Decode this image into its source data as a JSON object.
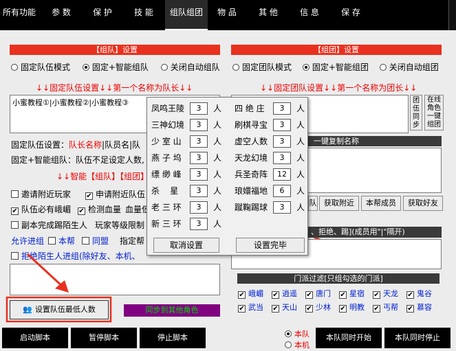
{
  "tabs": [
    "所有功能",
    "参 数",
    "保 护",
    "技 能",
    "组队组团",
    "物 品",
    "其 他",
    "信 息",
    "保 存"
  ],
  "team": {
    "header": "【组队】设置",
    "mode_options": [
      "固定队伍模式",
      "固定+智能组队",
      "关闭自动组队"
    ],
    "rule": "↓↓固定队伍设置↓↓第一个名称为队长↓↓",
    "textbox_value": "小蜜教程①|小蜜教程②|小蜜教程③",
    "note1_label": "固定队伍设置：",
    "note1_red": "队长名称",
    "note1_rest": "|队员名|队",
    "note2": "固定+智能组队：队伍不足设定人数,",
    "smart_label": "↓↓智能【组队】【组团】",
    "cb_invite": "邀请附近玩家",
    "cb_apply": "申请附近队伍",
    "cb_emei": "队伍必有峨嵋",
    "cb_hp": "检测血量",
    "hp_label": "血量低于",
    "cb_kick": "副本完成踢陌生人",
    "level_label": "玩家等级限制",
    "allow_label": "允许进组",
    "allow_opts": [
      "本帮",
      "同盟",
      "指定帮"
    ],
    "cb_refuse": "拒绝陌生人进组(除好友、本机、",
    "min_btn": "设置队伍最低人数",
    "sync_btn": "同步到其他角色"
  },
  "group": {
    "header": "【组团】设置",
    "mode_options": [
      "固定团队模式",
      "固定+智能组团",
      "关闭自动组团"
    ],
    "rule": "↓↓固定团队设置↓↓第一个名称为团长↓↓",
    "side_btn1": "团伍同步",
    "side_btn2": "在线角色一键组团",
    "copy_label": "一键复制名称",
    "action_btns": [
      "队",
      "获取附近",
      "本帮成员",
      "获取好友"
    ],
    "refuse_header": "、拒绝、踢](成员用\"|\"隔开)",
    "filter_header": "门派过滤[只组勾选的门派]",
    "sects": [
      "峨嵋",
      "逍遥",
      "唐门",
      "星宿",
      "天龙",
      "鬼谷",
      "武当",
      "天山",
      "少林",
      "明教",
      "丐帮",
      "慕容"
    ]
  },
  "popup": {
    "left": [
      {
        "name": "凤鸣王陵",
        "value": "3"
      },
      {
        "name": "三神幻境",
        "value": "3"
      },
      {
        "name": "少 室 山",
        "value": "3"
      },
      {
        "name": "燕 子 坞",
        "value": "3"
      },
      {
        "name": "缥 缈 峰",
        "value": "3"
      },
      {
        "name": "杀    星",
        "value": "3"
      },
      {
        "name": "老 三 环",
        "value": "3"
      },
      {
        "name": "新 三 环",
        "value": "3"
      }
    ],
    "right": [
      {
        "name": "四 绝 庄",
        "value": "3"
      },
      {
        "name": "刷棋寻宝",
        "value": "3"
      },
      {
        "name": "虚空人数",
        "value": "3"
      },
      {
        "name": "天龙幻境",
        "value": "3"
      },
      {
        "name": "兵圣奇阵",
        "value": "12"
      },
      {
        "name": "琅嬛福地",
        "value": "6"
      },
      {
        "name": "蹴鞠踢球",
        "value": "3"
      }
    ],
    "unit": "人",
    "cancel": "取消设置",
    "done": "设置完毕"
  },
  "bottom": {
    "buttons": [
      "启动脚本",
      "暂停脚本",
      "停止脚本"
    ],
    "radio_team": "本队",
    "radio_local": "本机",
    "start_sync": "本队同时开始",
    "stop_sync": "本队同时停止"
  },
  "colors": {
    "accent_red": "#e8311f",
    "sync_purple": "#800080",
    "sync_text": "#00dd00"
  }
}
